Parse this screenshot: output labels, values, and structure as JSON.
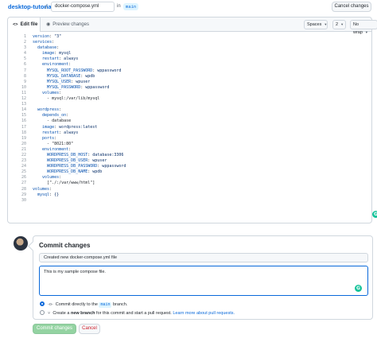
{
  "header": {
    "repo_name": "desktop-tutorial",
    "separator": "/",
    "filename_value": "docker-compose.yml",
    "in_label": "in",
    "branch": "main",
    "cancel_label": "Cancel changes"
  },
  "editor": {
    "tab_edit": "Edit file",
    "tab_preview": "Preview changes",
    "indent_mode": "Spaces",
    "indent_size": "2",
    "wrap_mode": "No wrap",
    "lines": [
      {
        "n": "1",
        "k": "version",
        "v": " \"3\""
      },
      {
        "n": "2",
        "k": "services",
        "v": ""
      },
      {
        "n": "3",
        "k": "  database",
        "v": ""
      },
      {
        "n": "4",
        "k": "    image",
        "v": " mysql"
      },
      {
        "n": "5",
        "k": "    restart",
        "v": " always"
      },
      {
        "n": "6",
        "k": "    environment",
        "v": ""
      },
      {
        "n": "7",
        "k": "      MYSQL_ROOT_PASSWORD",
        "v": " wppassword"
      },
      {
        "n": "8",
        "k": "      MYSQL_DATABASE",
        "v": " wpdb"
      },
      {
        "n": "9",
        "k": "      MYSQL_USER",
        "v": " wpuser"
      },
      {
        "n": "10",
        "k": "      MYSQL_PASSWORD",
        "v": " wppassword"
      },
      {
        "n": "11",
        "k": "    volumes",
        "v": ""
      },
      {
        "n": "12",
        "k": "",
        "v": "      - mysql:/var/lib/mysql"
      },
      {
        "n": "13",
        "k": "",
        "v": ""
      },
      {
        "n": "14",
        "k": "  wordpress",
        "v": ""
      },
      {
        "n": "15",
        "k": "    depends_on",
        "v": ""
      },
      {
        "n": "16",
        "k": "",
        "v": "      - database"
      },
      {
        "n": "17",
        "k": "    image",
        "v": " wordpress:latest"
      },
      {
        "n": "18",
        "k": "    restart",
        "v": " always"
      },
      {
        "n": "19",
        "k": "    ports",
        "v": ""
      },
      {
        "n": "20",
        "k": "",
        "v": "      - \"8021:80\""
      },
      {
        "n": "21",
        "k": "    environment",
        "v": ""
      },
      {
        "n": "22",
        "k": "      WORDPRESS_DB_HOST",
        "v": " database:3306"
      },
      {
        "n": "23",
        "k": "      WORDPRESS_DB_USER",
        "v": " wpuser"
      },
      {
        "n": "24",
        "k": "      WORDPRESS_DB_PASSWORD",
        "v": " wppassword"
      },
      {
        "n": "25",
        "k": "      WORDPRESS_DB_NAME",
        "v": " wpdb"
      },
      {
        "n": "26",
        "k": "    volumes",
        "v": ""
      },
      {
        "n": "27",
        "k": "",
        "v": "      [\"./:/var/www/html\"]"
      },
      {
        "n": "28",
        "k": "volumes",
        "v": ""
      },
      {
        "n": "29",
        "k": "  mysql",
        "v": " {}"
      },
      {
        "n": "30",
        "k": "",
        "v": ""
      }
    ]
  },
  "commit": {
    "title": "Commit changes",
    "summary_placeholder": "Created new docker-compose.yml file",
    "description_value": "This is my sample compose file.",
    "option_direct_prefix": "Commit directly to the",
    "option_direct_branch": "main",
    "option_direct_suffix": "branch.",
    "option_new_prefix": "Create a",
    "option_new_bold": "new branch",
    "option_new_middle": "for this commit and start a pull request.",
    "option_new_link": "Learn more about pull requests.",
    "commit_button": "Commit changes",
    "cancel_button": "Cancel"
  },
  "colors": {
    "accent": "#0969da",
    "grammarly": "#15c39a",
    "commit_disabled": "#94d3a2",
    "danger": "#cf222e"
  }
}
